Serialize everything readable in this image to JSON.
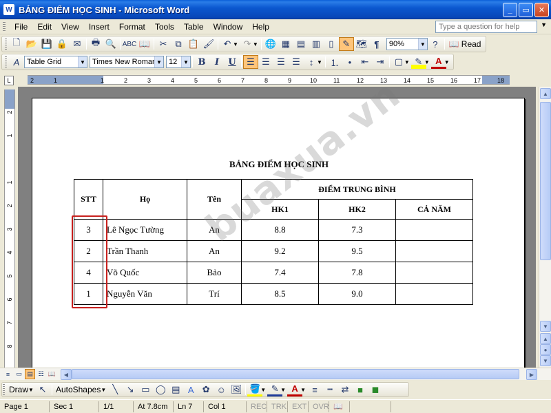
{
  "window": {
    "app_icon": "W",
    "title": "BẢNG ĐIỂM HỌC SINH - Microsoft Word",
    "buttons": [
      "_",
      "▭",
      "✕"
    ]
  },
  "menu": {
    "items": [
      "File",
      "Edit",
      "View",
      "Insert",
      "Format",
      "Tools",
      "Table",
      "Window",
      "Help"
    ],
    "help_placeholder": "Type a question for help"
  },
  "standard_toolbar": {
    "zoom": "90%",
    "read_label": "Read"
  },
  "formatting_toolbar": {
    "style": "Table Grid",
    "font": "Times New Roman",
    "size": "12",
    "bold": "B",
    "italic": "I",
    "underline": "U"
  },
  "ruler": {
    "corner_symbol": "L",
    "h_ticks": [
      "2",
      "1",
      "1",
      "2",
      "3",
      "4",
      "5",
      "6",
      "7",
      "8",
      "9",
      "10",
      "11",
      "12",
      "13",
      "14",
      "15",
      "16",
      "17",
      "18"
    ],
    "v_ticks": [
      "2",
      "1",
      "1",
      "2",
      "3",
      "4",
      "5",
      "6",
      "7",
      "8"
    ]
  },
  "document": {
    "title": "BẢNG ĐIỂM HỌC SINH",
    "watermark": "buaxua.vn",
    "headers": {
      "stt": "STT",
      "ho": "Họ",
      "ten": "Tên",
      "dtb": "ĐIỂM TRUNG BÌNH",
      "hk1": "HK1",
      "hk2": "HK2",
      "ca_nam": "CẢ NĂM"
    },
    "rows": [
      {
        "stt": "3",
        "ho": "Lê Ngọc Tường",
        "ten": "An",
        "hk1": "8.8",
        "hk2": "7.3",
        "ca_nam": ""
      },
      {
        "stt": "2",
        "ho": "Trần Thanh",
        "ten": "An",
        "hk1": "9.2",
        "hk2": "9.5",
        "ca_nam": ""
      },
      {
        "stt": "4",
        "ho": "Võ Quốc",
        "ten": "Bảo",
        "hk1": "7.4",
        "hk2": "7.8",
        "ca_nam": ""
      },
      {
        "stt": "1",
        "ho": "Nguyễn Văn",
        "ten": "Trí",
        "hk1": "8.5",
        "hk2": "9.0",
        "ca_nam": ""
      }
    ]
  },
  "drawing_toolbar": {
    "draw_label": "Draw",
    "autoshapes_label": "AutoShapes"
  },
  "statusbar": {
    "page": "Page 1",
    "sec": "Sec 1",
    "page_of": "1/1",
    "at": "At 7.8cm",
    "ln": "Ln 7",
    "col": "Col 1",
    "rec": "REC",
    "trk": "TRK",
    "ext": "EXT",
    "ovr": "OVR"
  },
  "colors": {
    "titlebar": "#0a5fd8",
    "highlight_box": "#c8201e",
    "ruler_margin": "#8aa2c8"
  }
}
